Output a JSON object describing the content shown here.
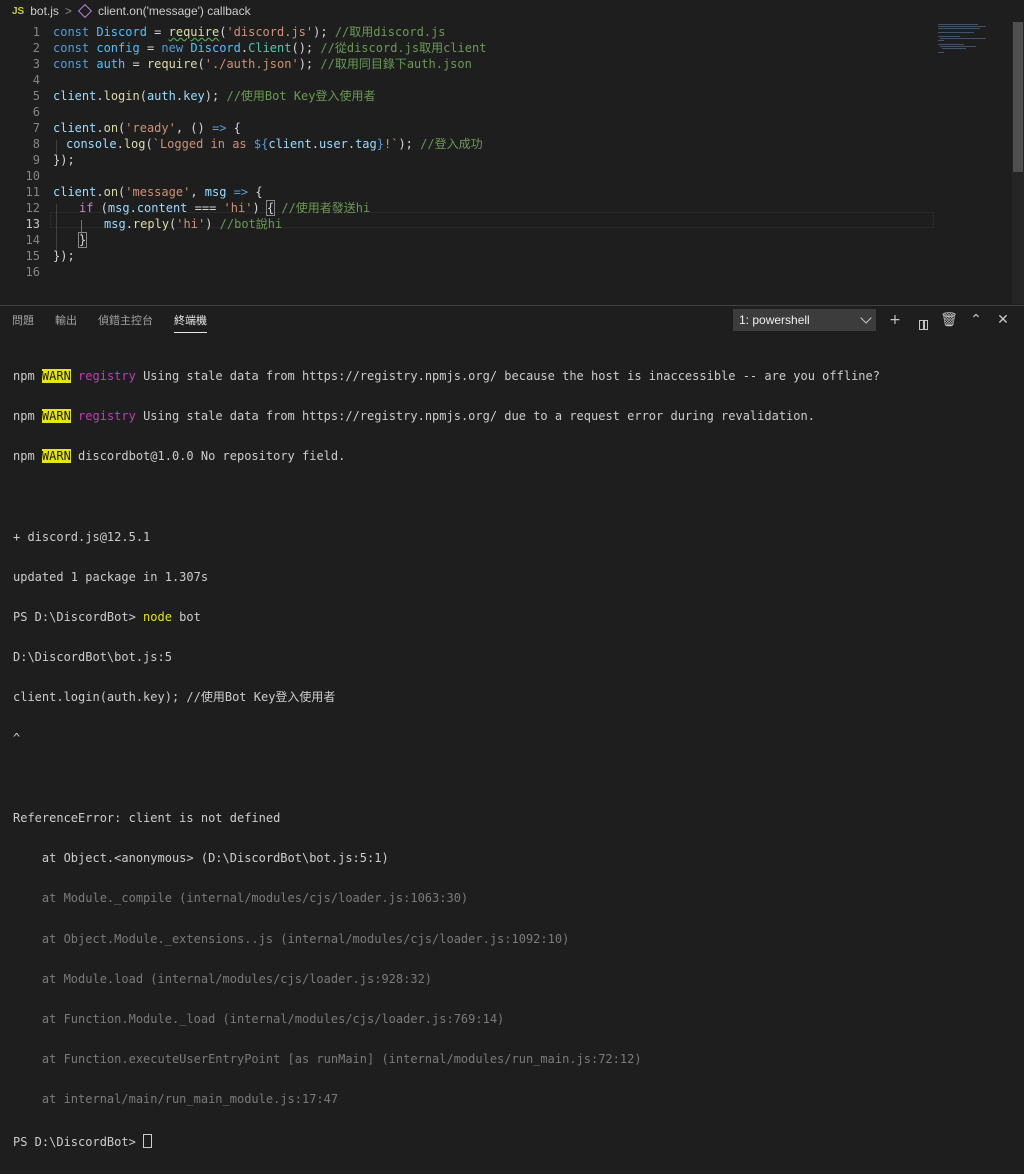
{
  "breadcrumb": {
    "file_badge": "JS",
    "file": "bot.js",
    "separator": ">",
    "symbol": "client.on('message') callback"
  },
  "editor": {
    "line_numbers": [
      "1",
      "2",
      "3",
      "4",
      "5",
      "6",
      "7",
      "8",
      "9",
      "10",
      "11",
      "12",
      "13",
      "14",
      "15",
      "16"
    ],
    "active_line": "13",
    "code": {
      "l1": [
        "const ",
        "Discord",
        " = ",
        "require",
        "(",
        "'discord.js'",
        "); ",
        "//取用discord.js"
      ],
      "l2": [
        "const ",
        "config",
        " = ",
        "new ",
        "Discord",
        ".",
        "Client",
        "(); ",
        "//從discord.js取用client"
      ],
      "l3": [
        "const ",
        "auth",
        " = ",
        "require",
        "(",
        "'./auth.json'",
        "); ",
        "//取用同目錄下auth.json"
      ],
      "l5": [
        "client",
        ".",
        "login",
        "(",
        "auth",
        ".",
        "key",
        "); ",
        "//使用Bot Key登入使用者"
      ],
      "l7": [
        "client",
        ".",
        "on",
        "(",
        "'ready'",
        ", () ",
        "=>",
        " {"
      ],
      "l8": [
        "console",
        ".",
        "log",
        "(",
        "`Logged in as ",
        "${",
        "client",
        ".",
        "user",
        ".",
        "tag",
        "}",
        "!`",
        "); ",
        "//登入成功"
      ],
      "l9": [
        "});"
      ],
      "l11": [
        "client",
        ".",
        "on",
        "(",
        "'message'",
        ", ",
        "msg",
        " => ",
        "{"
      ],
      "l12": [
        "if",
        " (",
        "msg",
        ".",
        "content",
        " === ",
        "'hi'",
        ") ",
        "{",
        " ",
        "//使用者發送hi"
      ],
      "l13": [
        "msg",
        ".",
        "reply",
        "(",
        "'hi'",
        ") ",
        "//bot說hi"
      ],
      "l14": [
        "}"
      ],
      "l15": [
        "});"
      ]
    }
  },
  "panel": {
    "tabs": [
      "問題",
      "輸出",
      "偵錯主控台",
      "終端機"
    ],
    "active_tab": "終端機",
    "terminal_select": "1: powershell",
    "icons": [
      "plus-icon",
      "split-terminal-icon",
      "trash-icon",
      "chevron-up-icon",
      "close-icon"
    ],
    "terminal": {
      "w1": [
        "npm ",
        "WARN",
        " ",
        "registry",
        " Using stale data from https://registry.npmjs.org/ because the host is inaccessible -- are you offline?"
      ],
      "w2": [
        "npm ",
        "WARN",
        " ",
        "registry",
        " Using stale data from https://registry.npmjs.org/ due to a request error during revalidation."
      ],
      "w3": [
        "npm ",
        "WARN",
        " discordbot@1.0.0 No repository field."
      ],
      "blank": "",
      "l4": "+ discord.js@12.5.1",
      "l5": "updated 1 package in 1.307s",
      "l6": [
        "PS D:\\DiscordBot> ",
        "node",
        " bot"
      ],
      "l7": "D:\\DiscordBot\\bot.js:5",
      "l8": "client.login(auth.key); //使用Bot Key登入使用者",
      "l9": "^",
      "l10": "ReferenceError: client is not defined",
      "l11": "    at Object.<anonymous> (D:\\DiscordBot\\bot.js:5:1)",
      "stack": [
        "    at Module._compile (internal/modules/cjs/loader.js:1063:30)",
        "    at Object.Module._extensions..js (internal/modules/cjs/loader.js:1092:10)",
        "    at Module.load (internal/modules/cjs/loader.js:928:32)",
        "    at Function.Module._load (internal/modules/cjs/loader.js:769:14)",
        "    at Function.executeUserEntryPoint [as runMain] (internal/modules/run_main.js:72:12)",
        "    at internal/main/run_main_module.js:17:47"
      ],
      "prompt": "PS D:\\DiscordBot> "
    }
  },
  "colors": {
    "background": "#1e1e1e",
    "keyword": "#569cd6",
    "string": "#ce9178",
    "comment": "#6a9955",
    "function": "#dcdcaa",
    "warn_bg": "#e5e510"
  }
}
